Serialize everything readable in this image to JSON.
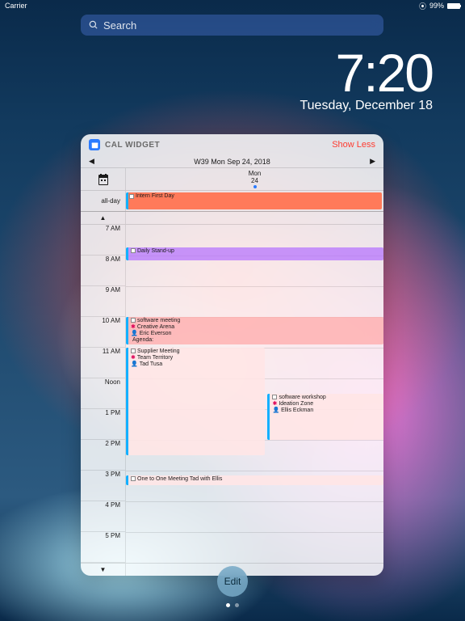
{
  "status": {
    "carrier": "Carrier",
    "battery_pct": "99%",
    "wifi": "wifi"
  },
  "search": {
    "placeholder": "Search"
  },
  "clock": {
    "time": "7:20",
    "date": "Tuesday, December 18"
  },
  "widget": {
    "title": "CAL WIDGET",
    "show_less": "Show Less",
    "weeknav": {
      "label": "W39 Mon Sep 24, 2018"
    },
    "day": {
      "dow": "Mon",
      "num": "24"
    },
    "allday_label": "all-day",
    "allday_event": {
      "title": "Intern First Day"
    },
    "up_arrow": "▲",
    "down_arrow": "▼",
    "hours": [
      "7 AM",
      "8 AM",
      "9 AM",
      "10 AM",
      "11 AM",
      "Noon",
      "1 PM",
      "2 PM",
      "3 PM",
      "4 PM",
      "5 PM"
    ],
    "events": {
      "standup": {
        "title": "Daily Stand-up"
      },
      "software_meeting": {
        "lines": [
          "software meeting",
          "Creative Arena",
          "Eric Everson",
          "Agenda:"
        ]
      },
      "supplier": {
        "lines": [
          "Supplier Meeting",
          "Team Territory",
          "Tad Tusa"
        ]
      },
      "workshop": {
        "lines": [
          "software workshop",
          "Ideation Zone",
          "Ellis Eckman"
        ]
      },
      "onetoone": {
        "title": "One to One Meeting Tad with Ellis"
      }
    }
  },
  "edit": "Edit"
}
